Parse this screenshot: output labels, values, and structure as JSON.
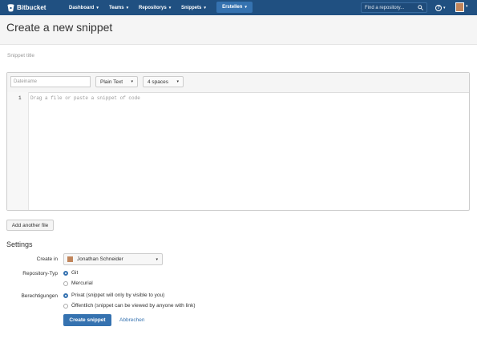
{
  "nav": {
    "brand": "Bitbucket",
    "items": [
      {
        "label": "Dashboard"
      },
      {
        "label": "Teams"
      },
      {
        "label": "Repositorys"
      },
      {
        "label": "Snippets"
      }
    ],
    "create_label": "Erstellen",
    "search_placeholder": "Find a repository...",
    "help_glyph": "?",
    "caret": "▾"
  },
  "page": {
    "title": "Create a new snippet",
    "snippet_title_placeholder": "Snippet title"
  },
  "editor": {
    "filename_placeholder": "Dateiname",
    "mode": "Plain Text",
    "indent": "4 spaces",
    "line_number": "1",
    "code_placeholder": "Drag a file or paste a snippet of code"
  },
  "add_file_label": "Add another file",
  "settings": {
    "heading": "Settings",
    "create_in_label": "Create in",
    "owner": "Jonathan Schneider",
    "repo_type_label": "Repository-Typ",
    "repo_types": [
      {
        "label": "Git",
        "selected": true
      },
      {
        "label": "Mercurial",
        "selected": false
      }
    ],
    "permissions_label": "Berechtigungen",
    "permissions": [
      {
        "label": "Privat (snippet will only by visible to you)",
        "selected": true
      },
      {
        "label": "Öffentlich (snippet can be viewed by anyone with link)",
        "selected": false
      }
    ],
    "submit_label": "Create snippet",
    "cancel_label": "Abbrechen"
  },
  "colors": {
    "header_bg": "#205081",
    "primary": "#3572b0",
    "page_header_bg": "#f5f5f5"
  }
}
